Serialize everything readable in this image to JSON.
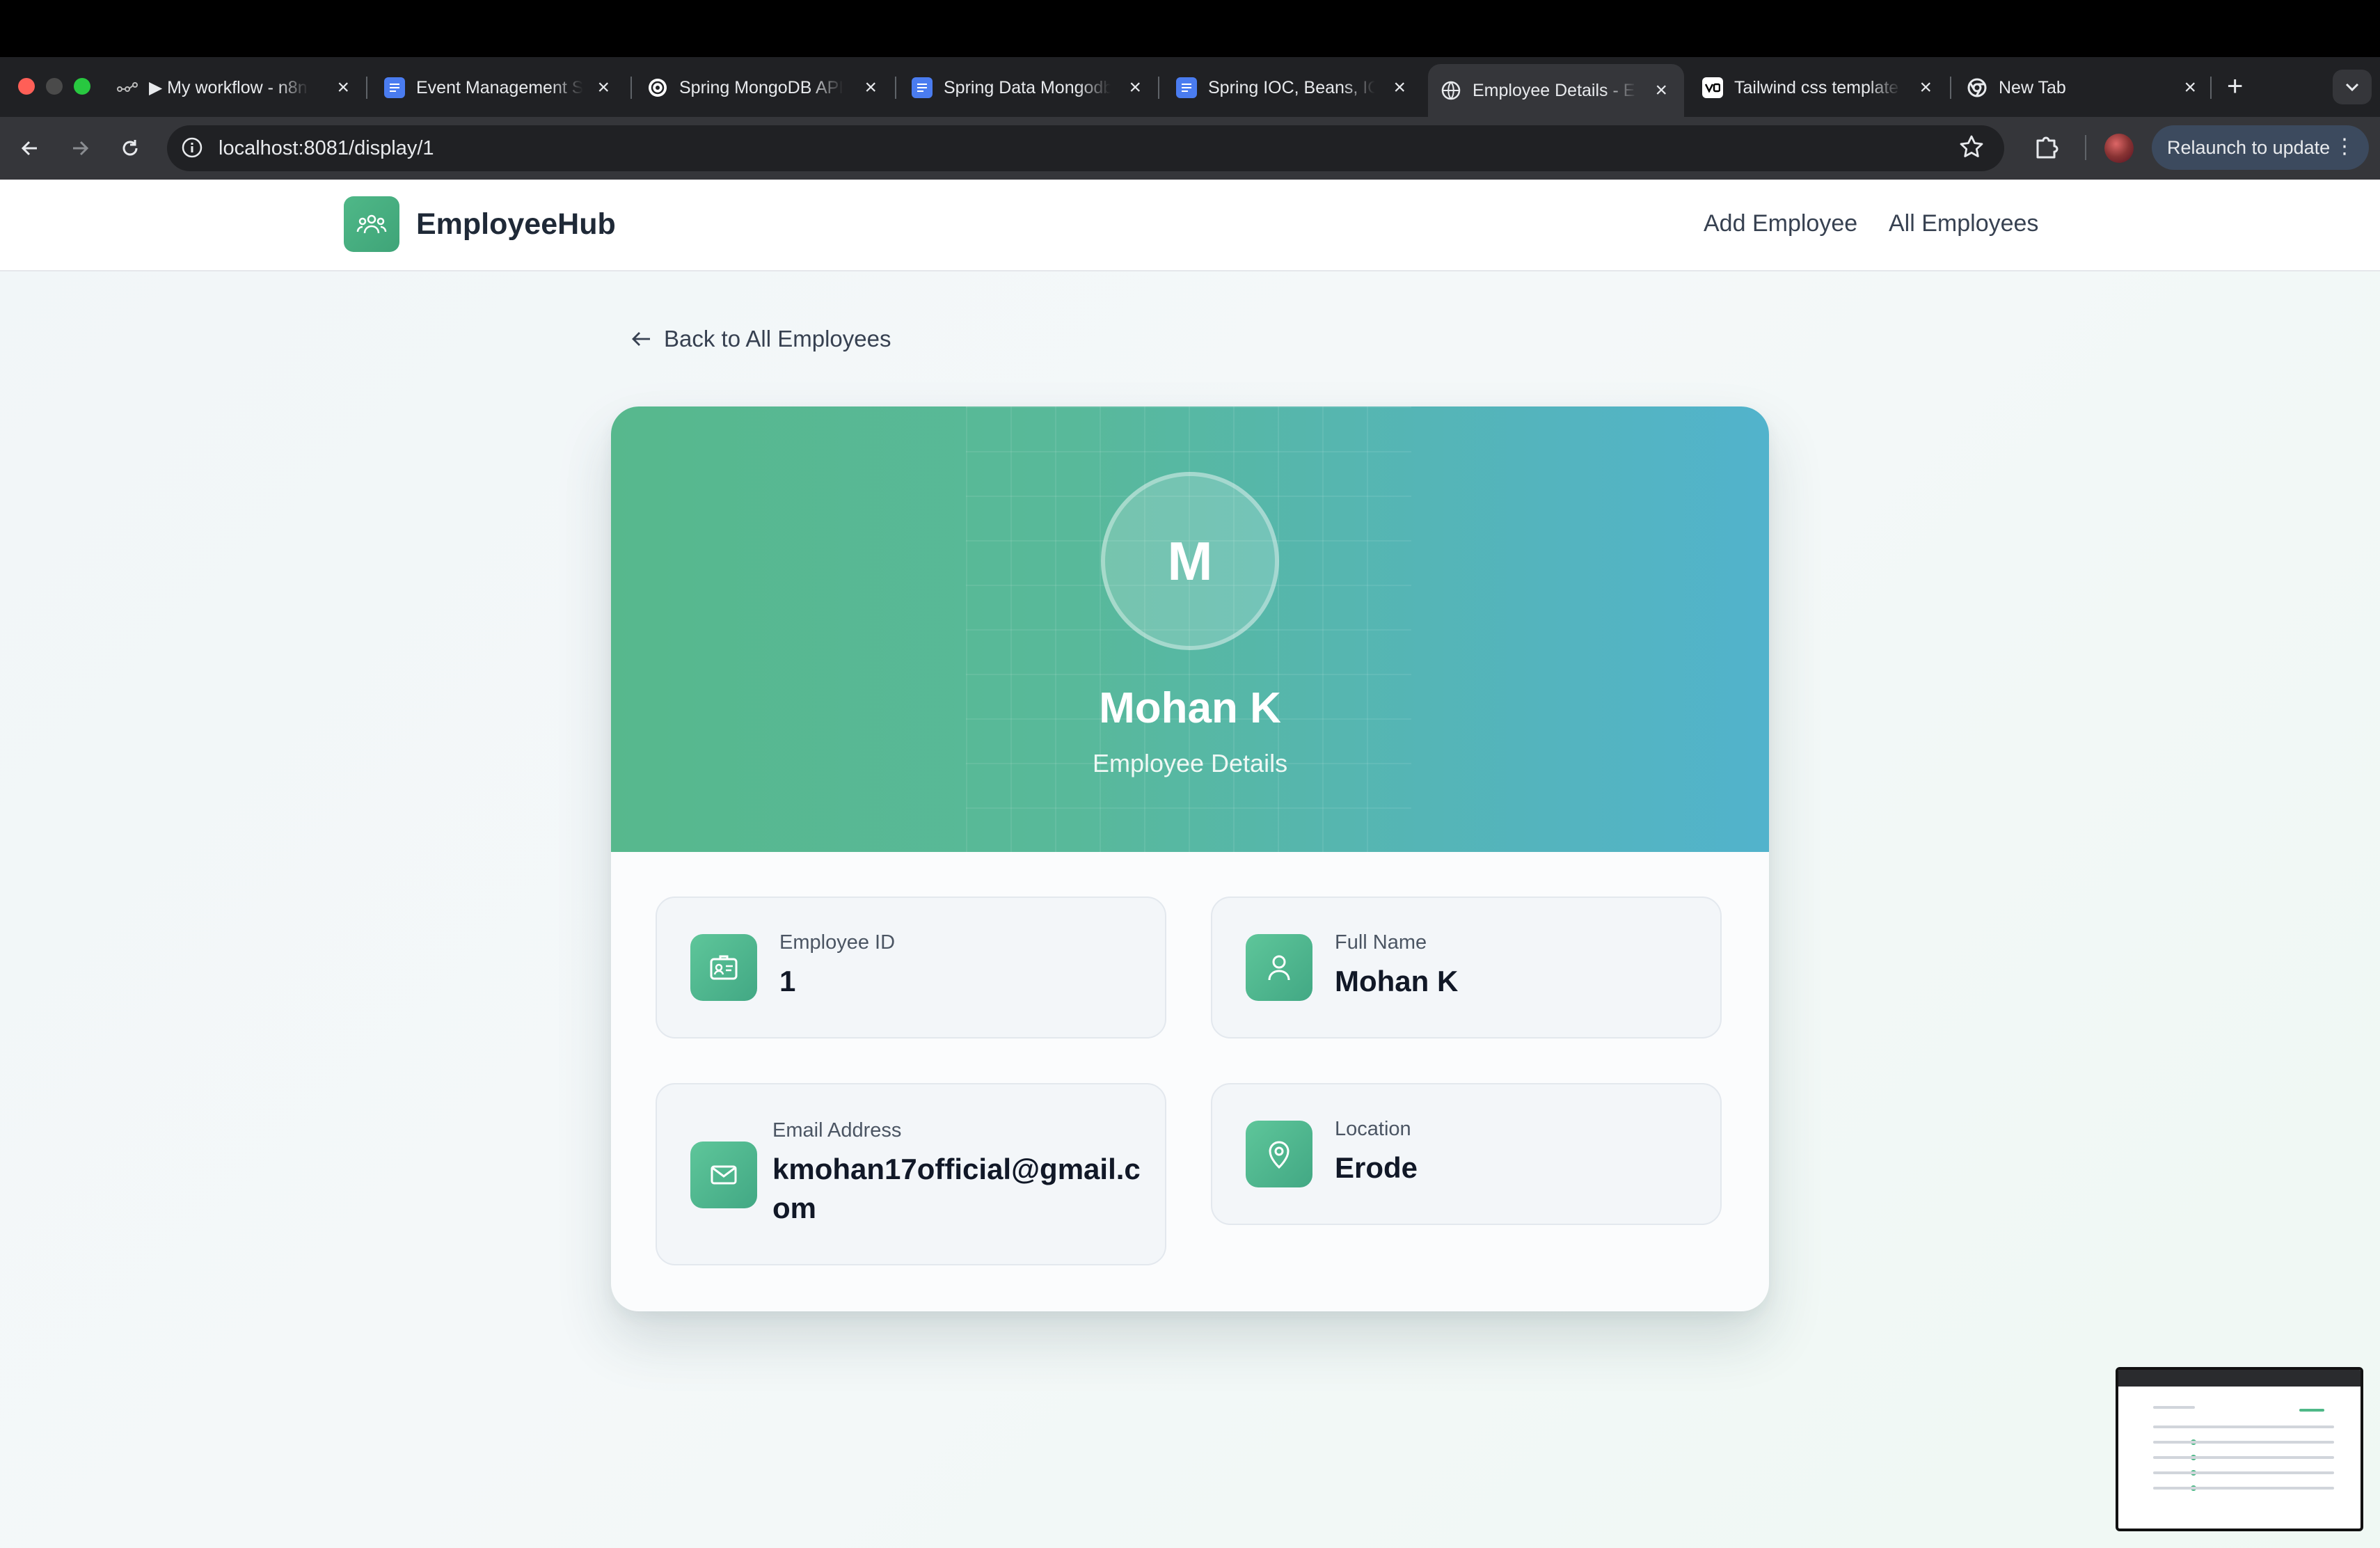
{
  "browser": {
    "tabs": [
      {
        "title": "▶ My workflow - n8n",
        "icon": "n8n-workflow-icon"
      },
      {
        "title": "Event Management S",
        "icon": "google-docs-icon"
      },
      {
        "title": "Spring MongoDB API",
        "icon": "openai-icon"
      },
      {
        "title": "Spring Data Mongodb",
        "icon": "google-docs-icon"
      },
      {
        "title": "Spring IOC, Beans, IOC",
        "icon": "google-docs-icon"
      },
      {
        "title": "Employee Details - E",
        "icon": "globe-icon",
        "active": true
      },
      {
        "title": "Tailwind css template",
        "icon": "v0-icon"
      },
      {
        "title": "New Tab",
        "icon": "chrome-icon"
      }
    ],
    "url": "localhost:8081/display/1",
    "relaunch_label": "Relaunch to update"
  },
  "app": {
    "brand": "EmployeeHub",
    "nav": {
      "add": "Add Employee",
      "all": "All Employees"
    },
    "back_label": "Back to All Employees",
    "employee": {
      "initial": "M",
      "name": "Mohan K",
      "subtitle": "Employee Details",
      "fields": {
        "id": {
          "label": "Employee ID",
          "value": "1"
        },
        "name": {
          "label": "Full Name",
          "value": "Mohan K"
        },
        "email": {
          "label": "Email Address",
          "value_line1": "kmohan17official@gmail.c",
          "value_line2": "om"
        },
        "location": {
          "label": "Location",
          "value": "Erode"
        }
      }
    },
    "accent_color": "#4fb888"
  }
}
